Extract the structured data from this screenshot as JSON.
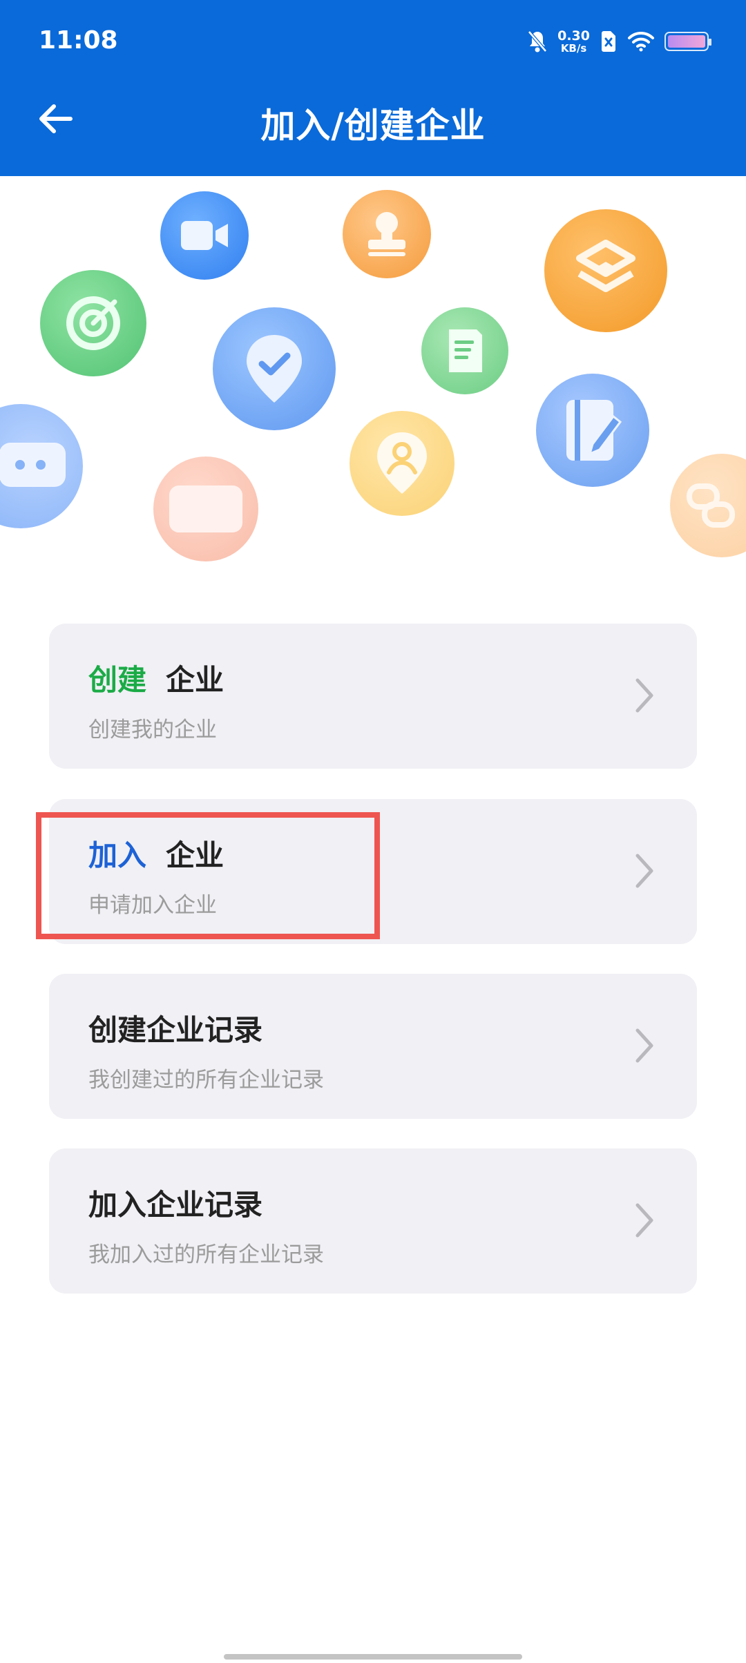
{
  "status_bar": {
    "time": "11:08",
    "net_speed_value": "0.30",
    "net_speed_unit": "KB/s",
    "icons": [
      "bell-off-icon",
      "blocked-sim-icon",
      "wifi-icon",
      "battery-icon"
    ]
  },
  "header": {
    "title": "加入/创建企业",
    "back_icon": "arrow-left-icon",
    "background": "#0a6ad9"
  },
  "hero": {
    "icons": [
      "target-icon",
      "video-camera-icon",
      "stamp-icon",
      "layers-icon",
      "location-check-icon",
      "document-icon",
      "chat-icon",
      "person-pin-icon",
      "notebook-edit-icon",
      "card-icon",
      "link-icon"
    ]
  },
  "cards": [
    {
      "title_accent": "创建",
      "title_rest": "企业",
      "accent_color": "#1bab46",
      "subtitle": "创建我的企业"
    },
    {
      "title_accent": "加入",
      "title_rest": "企业",
      "accent_color": "#1d62d6",
      "subtitle": "申请加入企业"
    },
    {
      "title": "创建企业记录",
      "subtitle": "我创建过的所有企业记录"
    },
    {
      "title": "加入企业记录",
      "subtitle": "我加入过的所有企业记录"
    }
  ],
  "highlight_color": "#ee5550"
}
